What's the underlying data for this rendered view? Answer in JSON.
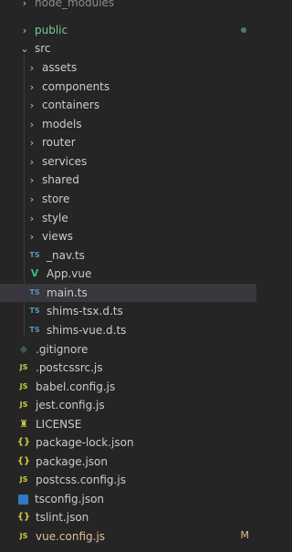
{
  "explorer": {
    "items": [
      {
        "label": "node_modules",
        "kind": "folder-collapsed"
      },
      {
        "label": "public",
        "kind": "folder-collapsed"
      },
      {
        "label": "src",
        "kind": "folder-expanded"
      },
      {
        "label": "assets",
        "kind": "folder-collapsed"
      },
      {
        "label": "components",
        "kind": "folder-collapsed"
      },
      {
        "label": "containers",
        "kind": "folder-collapsed"
      },
      {
        "label": "models",
        "kind": "folder-collapsed"
      },
      {
        "label": "router",
        "kind": "folder-collapsed"
      },
      {
        "label": "services",
        "kind": "folder-collapsed"
      },
      {
        "label": "shared",
        "kind": "folder-collapsed"
      },
      {
        "label": "store",
        "kind": "folder-collapsed"
      },
      {
        "label": "style",
        "kind": "folder-collapsed"
      },
      {
        "label": "views",
        "kind": "folder-collapsed"
      },
      {
        "label": "_nav.ts",
        "kind": "file",
        "icon_text": "TS"
      },
      {
        "label": "App.vue",
        "kind": "file",
        "icon_text": "V"
      },
      {
        "label": "main.ts",
        "kind": "file",
        "icon_text": "TS",
        "selected": true
      },
      {
        "label": "shims-tsx.d.ts",
        "kind": "file",
        "icon_text": "TS"
      },
      {
        "label": "shims-vue.d.ts",
        "kind": "file",
        "icon_text": "TS"
      },
      {
        "label": ".gitignore",
        "kind": "file",
        "icon_text": "◆"
      },
      {
        "label": ".postcssrc.js",
        "kind": "file",
        "icon_text": "JS"
      },
      {
        "label": "babel.config.js",
        "kind": "file",
        "icon_text": "JS"
      },
      {
        "label": "jest.config.js",
        "kind": "file",
        "icon_text": "JS"
      },
      {
        "label": "LICENSE",
        "kind": "file",
        "icon_text": "♜"
      },
      {
        "label": "package-lock.json",
        "kind": "file",
        "icon_text": "{}"
      },
      {
        "label": "package.json",
        "kind": "file",
        "icon_text": "{}"
      },
      {
        "label": "postcss.config.js",
        "kind": "file",
        "icon_text": "JS"
      },
      {
        "label": "tsconfig.json",
        "kind": "file",
        "icon_text": ""
      },
      {
        "label": "tslint.json",
        "kind": "file",
        "icon_text": "{}"
      },
      {
        "label": "vue.config.js",
        "kind": "file",
        "icon_text": "JS",
        "status": "M"
      }
    ],
    "chevron_right": "›",
    "chevron_down": "⌄"
  },
  "colors": {
    "background": "#252526",
    "selected_row": "#37373d",
    "untracked_green": "#73c991",
    "modified_yellow": "#e2c08d",
    "ts_blue": "#519aba",
    "js_yellow": "#cbcb41"
  }
}
